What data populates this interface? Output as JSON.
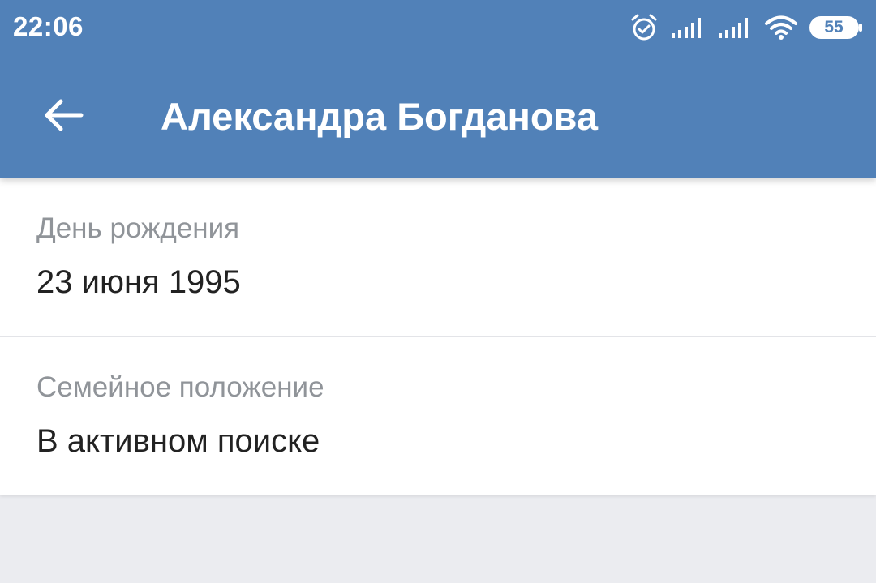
{
  "status_bar": {
    "time": "22:06",
    "battery": "55",
    "icons": [
      "alarm-icon",
      "signal-icon",
      "signal-icon",
      "wifi-icon",
      "battery-icon"
    ]
  },
  "toolbar": {
    "title": "Александра Богданова",
    "back_icon": "arrow-left-icon"
  },
  "info": [
    {
      "label": "День рождения",
      "value": "23 июня 1995"
    },
    {
      "label": "Семейное положение",
      "value": "В активном поиске"
    }
  ],
  "colors": {
    "header": "#5181b8",
    "background": "#ebecf0",
    "label": "#909499",
    "value": "#222222"
  }
}
